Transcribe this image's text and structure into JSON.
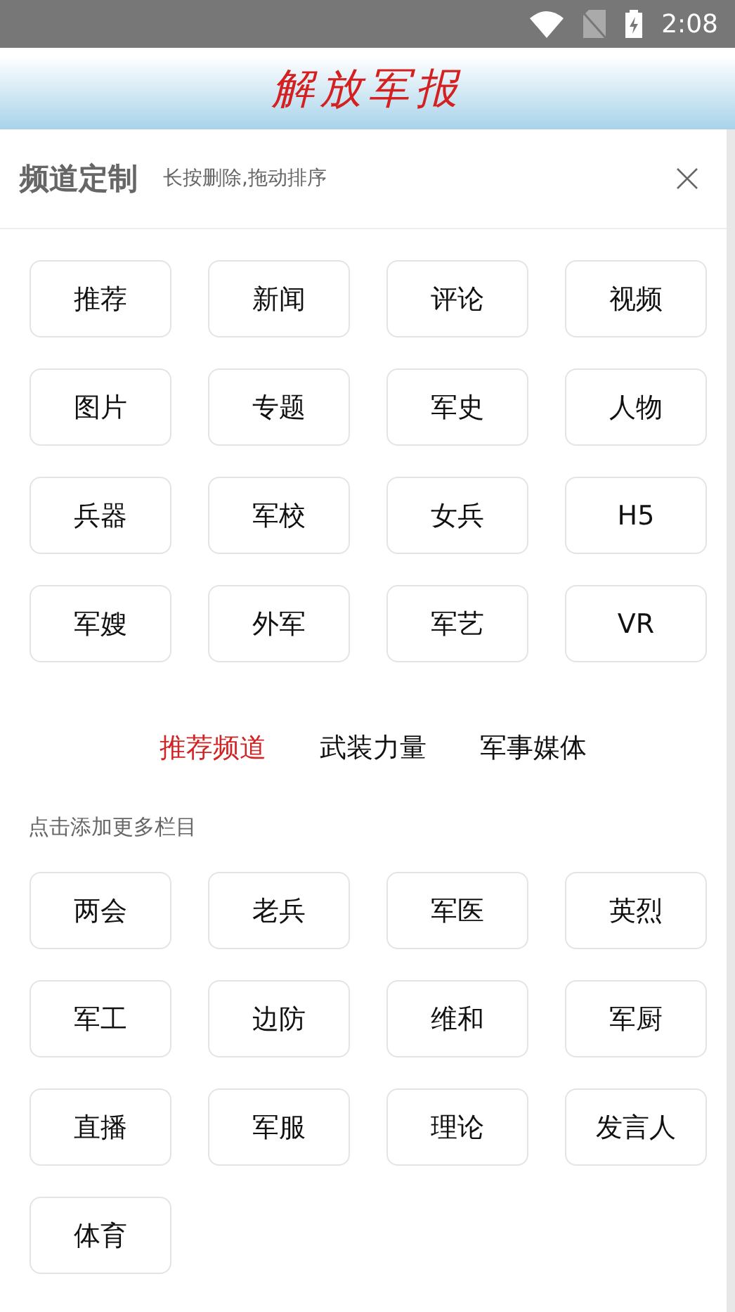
{
  "status_bar": {
    "time": "2:08"
  },
  "header": {
    "logo": "解放军报"
  },
  "panel": {
    "title": "频道定制",
    "hint": "长按删除,拖动排序"
  },
  "my_channels": [
    "推荐",
    "新闻",
    "评论",
    "视频",
    "图片",
    "专题",
    "军史",
    "人物",
    "兵器",
    "军校",
    "女兵",
    "H5",
    "军嫂",
    "外军",
    "军艺",
    "VR"
  ],
  "category_tabs": [
    {
      "label": "推荐频道",
      "selected": true
    },
    {
      "label": "武装力量",
      "selected": false
    },
    {
      "label": "军事媒体",
      "selected": false
    }
  ],
  "more_hint": "点击添加更多栏目",
  "more_channels": [
    "两会",
    "老兵",
    "军医",
    "英烈",
    "军工",
    "边防",
    "维和",
    "军厨",
    "直播",
    "军服",
    "理论",
    "发言人",
    "体育"
  ]
}
